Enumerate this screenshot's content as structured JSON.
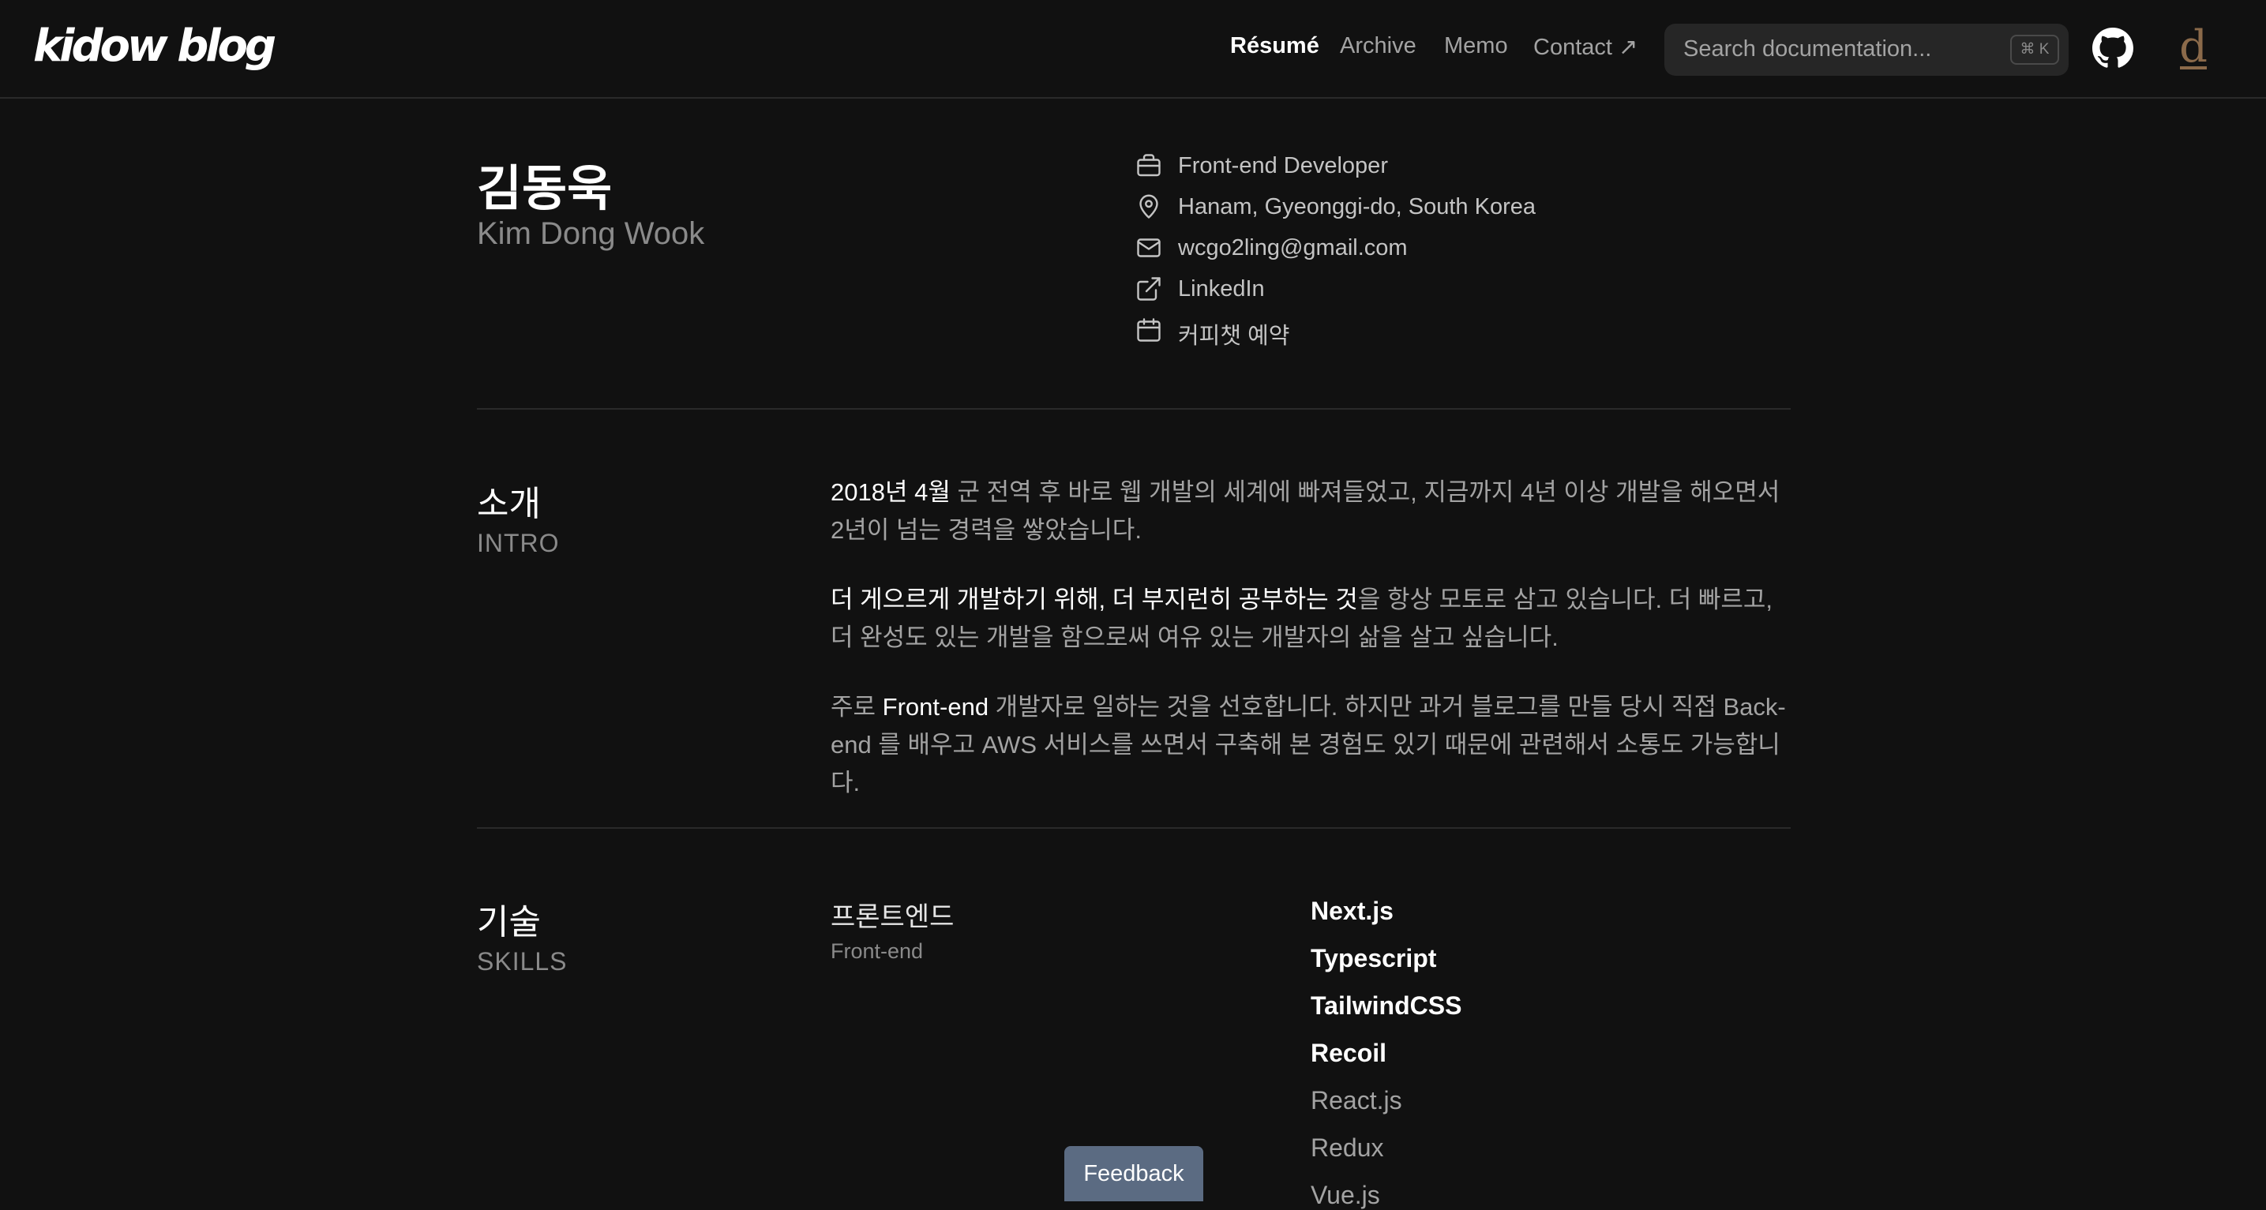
{
  "header": {
    "logo": "kidow blog",
    "nav": [
      {
        "label": "Résumé",
        "active": true
      },
      {
        "label": "Archive",
        "active": false
      },
      {
        "label": "Memo",
        "active": false
      },
      {
        "label": "Contact ↗",
        "active": false
      }
    ],
    "search": {
      "placeholder": "Search documentation...",
      "shortcut": "⌘ K"
    },
    "github_icon": "github-icon",
    "avatar_letter": "d"
  },
  "profile": {
    "name_ko": "김동욱",
    "name_en": "Kim Dong Wook",
    "info": [
      {
        "icon": "briefcase-icon",
        "text": "Front-end Developer"
      },
      {
        "icon": "map-pin-icon",
        "text": "Hanam, Gyeonggi-do, South Korea"
      },
      {
        "icon": "mail-icon",
        "text": "wcgo2ling@gmail.com"
      },
      {
        "icon": "external-link-icon",
        "text": "LinkedIn"
      },
      {
        "icon": "calendar-icon",
        "text": "커피챗 예약"
      }
    ]
  },
  "intro": {
    "title": "소개",
    "subtitle": "INTRO",
    "p1_highlight": "2018년 4월",
    "p1_rest": " 군 전역 후 바로 웹 개발의 세계에 빠져들었고, 지금까지 4년 이상 개발을 해오면서 2년이 넘는 경력을 쌓았습니다.",
    "p2_highlight": "더 게으르게 개발하기 위해, 더 부지런히 공부하는 것",
    "p2_rest": "을 항상 모토로 삼고 있습니다. 더 빠르고, 더 완성도 있는 개발을 함으로써 여유 있는 개발자의 삶을 살고 싶습니다.",
    "p3_pre": "주로 ",
    "p3_highlight": "Front-end",
    "p3_rest": " 개발자로 일하는 것을 선호합니다. 하지만 과거 블로그를 만들 당시 직접 Back-end 를 배우고 AWS 서비스를 쓰면서 구축해 본 경험도 있기 때문에 관련해서 소통도 가능합니다."
  },
  "skills": {
    "title": "기술",
    "subtitle": "SKILLS",
    "category_title": "프론트엔드",
    "category_sub": "Front-end",
    "items": [
      {
        "label": "Next.js",
        "strong": true
      },
      {
        "label": "Typescript",
        "strong": true
      },
      {
        "label": "TailwindCSS",
        "strong": true
      },
      {
        "label": "Recoil",
        "strong": true
      },
      {
        "label": "React.js",
        "strong": false
      },
      {
        "label": "Redux",
        "strong": false
      },
      {
        "label": "Vue.js",
        "strong": false
      }
    ]
  },
  "feedback_label": "Feedback"
}
